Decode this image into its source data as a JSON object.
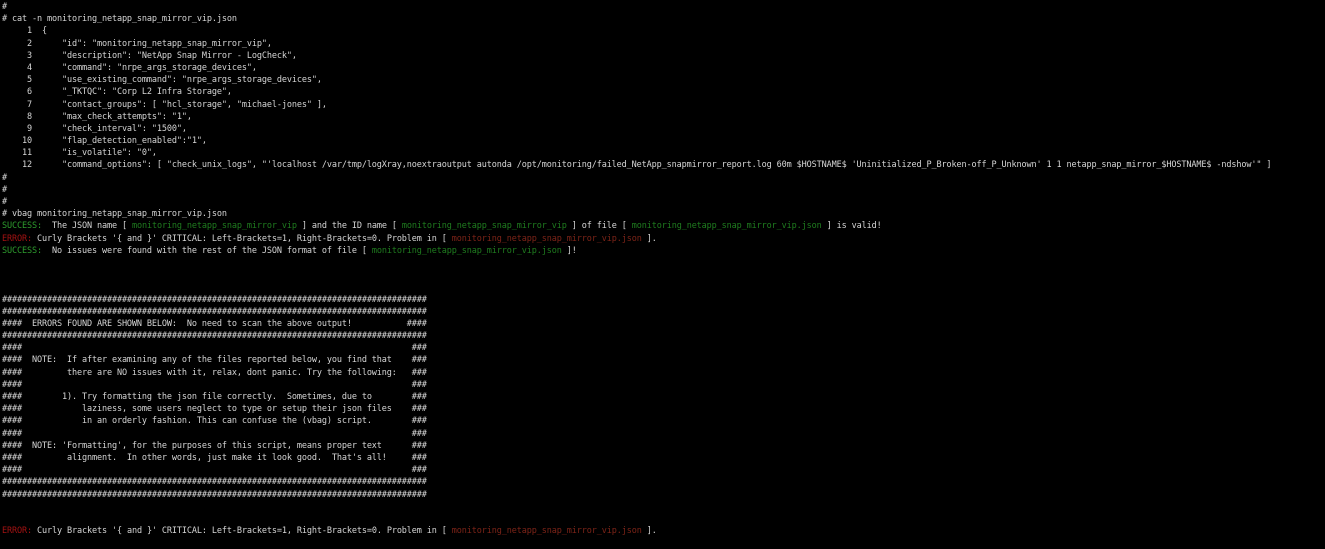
{
  "colors": {
    "bg": "#000000",
    "fg": "#d6d6d6",
    "success": "#2e9e2e",
    "success_file": "#1f7d1f",
    "error": "#a31212",
    "error_file": "#7e2418"
  },
  "meta": {
    "file_name": "monitoring_netapp_snap_mirror_vip.json",
    "command_1": "cat -n monitoring_netapp_snap_mirror_vip.json",
    "command_2": "vbag monitoring_netapp_snap_mirror_vip.json"
  },
  "terminal": {
    "lines": [
      [
        {
          "t": "#",
          "c": "fg",
          "n": "shell-prompt"
        }
      ],
      [
        {
          "t": "# cat -n monitoring_netapp_snap_mirror_vip.json",
          "c": "fg",
          "n": "command-cat"
        }
      ],
      [
        {
          "t": "     1  {",
          "c": "fg",
          "n": "json-line"
        }
      ],
      [
        {
          "t": "     2      \"id\": \"monitoring_netapp_snap_mirror_vip\",",
          "c": "fg",
          "n": "json-line"
        }
      ],
      [
        {
          "t": "     3      \"description\": \"NetApp Snap Mirror - LogCheck\",",
          "c": "fg",
          "n": "json-line"
        }
      ],
      [
        {
          "t": "     4      \"command\": \"nrpe_args_storage_devices\",",
          "c": "fg",
          "n": "json-line"
        }
      ],
      [
        {
          "t": "     5      \"use_existing_command\": \"nrpe_args_storage_devices\",",
          "c": "fg",
          "n": "json-line"
        }
      ],
      [
        {
          "t": "     6      \"_TKTQC\": \"Corp L2 Infra Storage\",",
          "c": "fg",
          "n": "json-line"
        }
      ],
      [
        {
          "t": "     7      \"contact_groups\": [ \"hcl_storage\", \"michael-jones\" ],",
          "c": "fg",
          "n": "json-line"
        }
      ],
      [
        {
          "t": "     8      \"max_check_attempts\": \"1\",",
          "c": "fg",
          "n": "json-line"
        }
      ],
      [
        {
          "t": "     9      \"check_interval\": \"1500\",",
          "c": "fg",
          "n": "json-line"
        }
      ],
      [
        {
          "t": "    10      \"flap_detection_enabled\":\"1\",",
          "c": "fg",
          "n": "json-line"
        }
      ],
      [
        {
          "t": "    11      \"is_volatile\": \"0\",",
          "c": "fg",
          "n": "json-line"
        }
      ],
      [
        {
          "t": "    12      \"command_options\": [ \"check_unix_logs\", \"'localhost /var/tmp/logXray,noextraoutput autonda /opt/monitoring/failed_NetApp_snapmirror_report.log 60m $HOSTNAME$ 'Uninitialized_P_Broken-off_P_Unknown' 1 1 netapp_snap_mirror_$HOSTNAME$ -ndshow'\" ]",
          "c": "fg",
          "n": "json-line"
        }
      ],
      [
        {
          "t": "#",
          "c": "fg",
          "n": "shell-prompt"
        }
      ],
      [
        {
          "t": "#",
          "c": "fg",
          "n": "shell-prompt"
        }
      ],
      [
        {
          "t": "#",
          "c": "fg",
          "n": "shell-prompt"
        }
      ],
      [
        {
          "t": "# vbag monitoring_netapp_snap_mirror_vip.json",
          "c": "fg",
          "n": "command-vbag"
        }
      ],
      [
        {
          "t": "SUCCESS:",
          "c": "success",
          "n": "success-label"
        },
        {
          "t": "  The JSON name [ ",
          "c": "fg",
          "n": "terminal-text"
        },
        {
          "t": "monitoring_netapp_snap_mirror_vip",
          "c": "success_file",
          "n": "highlighted-filename"
        },
        {
          "t": " ] and the ID name [ ",
          "c": "fg",
          "n": "terminal-text"
        },
        {
          "t": "monitoring_netapp_snap_mirror_vip",
          "c": "success_file",
          "n": "highlighted-filename"
        },
        {
          "t": " ] of file [ ",
          "c": "fg",
          "n": "terminal-text"
        },
        {
          "t": "monitoring_netapp_snap_mirror_vip.json",
          "c": "success_file",
          "n": "highlighted-filename"
        },
        {
          "t": " ] is valid!",
          "c": "fg",
          "n": "terminal-text"
        }
      ],
      [
        {
          "t": "ERROR:",
          "c": "error",
          "n": "error-label"
        },
        {
          "t": " Curly Brackets '{ and }' CRITICAL: Left-Brackets=1, Right-Brackets=0. Problem in [ ",
          "c": "fg",
          "n": "terminal-text"
        },
        {
          "t": "monitoring_netapp_snap_mirror_vip.json",
          "c": "error_file",
          "n": "error-filename"
        },
        {
          "t": " ].",
          "c": "fg",
          "n": "terminal-text"
        }
      ],
      [
        {
          "t": "SUCCESS:",
          "c": "success",
          "n": "success-label"
        },
        {
          "t": "  No issues were found with the rest of the JSON format of file [ ",
          "c": "fg",
          "n": "terminal-text"
        },
        {
          "t": "monitoring_netapp_snap_mirror_vip.json",
          "c": "success_file",
          "n": "highlighted-filename"
        },
        {
          "t": " ]!",
          "c": "fg",
          "n": "terminal-text"
        }
      ],
      [],
      [],
      [],
      [
        {
          "t": "#####################################################################################",
          "c": "fg",
          "n": "ascii-banner-border"
        }
      ],
      [
        {
          "t": "#####################################################################################",
          "c": "fg",
          "n": "ascii-banner-border"
        }
      ],
      [
        {
          "t": "####  ERRORS FOUND ARE SHOWN BELOW:  No need to scan the above output!           ####",
          "c": "fg",
          "n": "ascii-banner-title"
        }
      ],
      [
        {
          "t": "#####################################################################################",
          "c": "fg",
          "n": "ascii-banner-border"
        }
      ],
      [
        {
          "t": "####                                                                              ###",
          "c": "fg",
          "n": "ascii-banner-row"
        }
      ],
      [
        {
          "t": "####  NOTE:  If after examining any of the files reported below, you find that    ###",
          "c": "fg",
          "n": "ascii-banner-row"
        }
      ],
      [
        {
          "t": "####         there are NO issues with it, relax, dont panic. Try the following:   ###",
          "c": "fg",
          "n": "ascii-banner-row"
        }
      ],
      [
        {
          "t": "####                                                                              ###",
          "c": "fg",
          "n": "ascii-banner-row"
        }
      ],
      [
        {
          "t": "####        1). Try formatting the json file correctly.  Sometimes, due to        ###",
          "c": "fg",
          "n": "ascii-banner-row"
        }
      ],
      [
        {
          "t": "####            laziness, some users neglect to type or setup their json files    ###",
          "c": "fg",
          "n": "ascii-banner-row"
        }
      ],
      [
        {
          "t": "####            in an orderly fashion. This can confuse the (vbag) script.        ###",
          "c": "fg",
          "n": "ascii-banner-row"
        }
      ],
      [
        {
          "t": "####                                                                              ###",
          "c": "fg",
          "n": "ascii-banner-row"
        }
      ],
      [
        {
          "t": "####  NOTE: 'Formatting', for the purposes of this script, means proper text      ###",
          "c": "fg",
          "n": "ascii-banner-row"
        }
      ],
      [
        {
          "t": "####         alignment.  In other words, just make it look good.  That's all!     ###",
          "c": "fg",
          "n": "ascii-banner-row"
        }
      ],
      [
        {
          "t": "####                                                                              ###",
          "c": "fg",
          "n": "ascii-banner-row"
        }
      ],
      [
        {
          "t": "#####################################################################################",
          "c": "fg",
          "n": "ascii-banner-border"
        }
      ],
      [
        {
          "t": "#####################################################################################",
          "c": "fg",
          "n": "ascii-banner-border"
        }
      ],
      [],
      [],
      [
        {
          "t": "ERROR:",
          "c": "error",
          "n": "error-label"
        },
        {
          "t": " Curly Brackets '{ and }' CRITICAL: Left-Brackets=1, Right-Brackets=0. Problem in [ ",
          "c": "fg",
          "n": "terminal-text"
        },
        {
          "t": "monitoring_netapp_snap_mirror_vip.json",
          "c": "error_file",
          "n": "error-filename"
        },
        {
          "t": " ].",
          "c": "fg",
          "n": "terminal-text"
        }
      ],
      []
    ]
  }
}
